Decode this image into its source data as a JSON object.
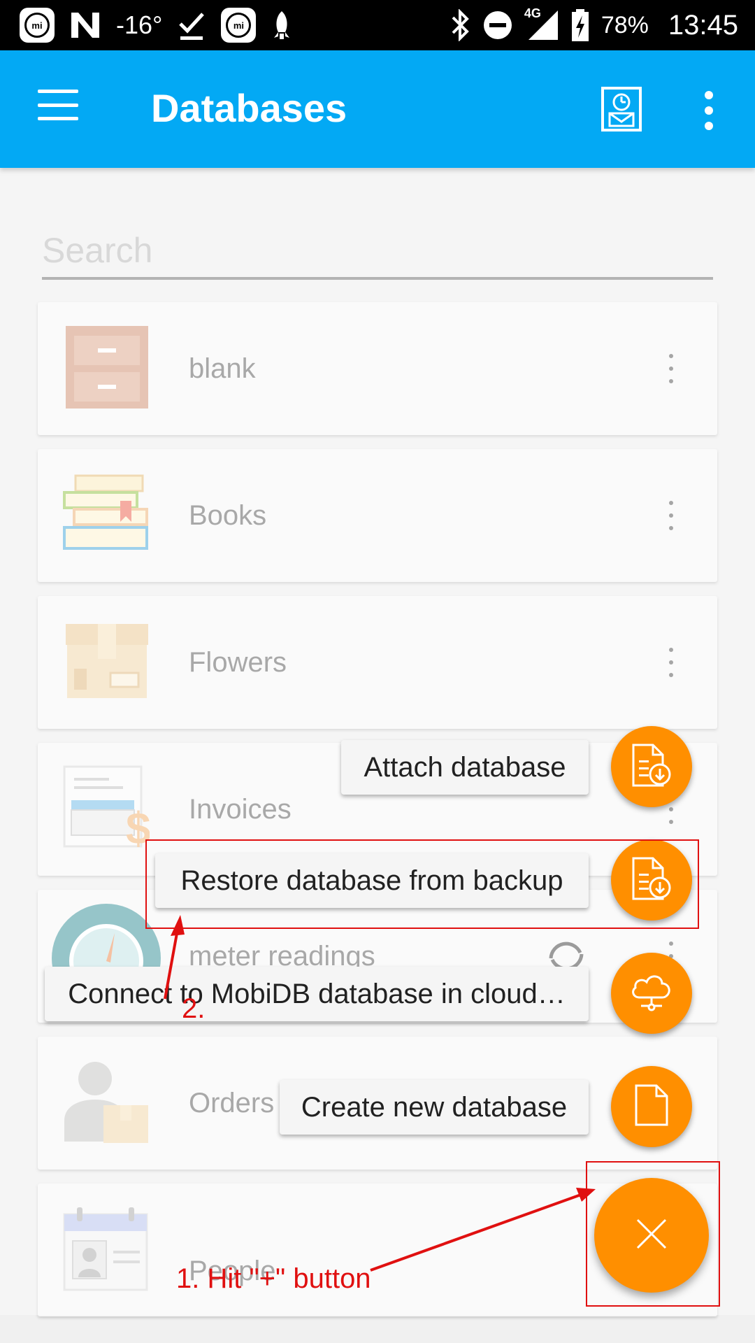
{
  "status_bar": {
    "temperature": "-16°",
    "network": "4G",
    "battery": "78%",
    "time": "13:45",
    "icons_left": [
      "mi-icon",
      "n-icon",
      "temperature-text",
      "download-done-icon",
      "mi-icon",
      "rocket-icon"
    ],
    "icons_right": [
      "bluetooth-icon",
      "do-not-disturb-icon",
      "signal-icon",
      "battery-charging-icon"
    ]
  },
  "app_bar": {
    "title": "Databases",
    "color": "#03a9f4"
  },
  "search": {
    "placeholder": "Search"
  },
  "databases": [
    {
      "name": "blank",
      "icon": "cabinet-icon"
    },
    {
      "name": "Books",
      "icon": "books-icon"
    },
    {
      "name": "Flowers",
      "icon": "box-icon"
    },
    {
      "name": "Invoices",
      "icon": "invoice-icon"
    },
    {
      "name": "meter readings",
      "icon": "gauge-icon"
    },
    {
      "name": "Orders",
      "icon": "person-box-icon"
    },
    {
      "name": "People",
      "icon": "contact-card-icon"
    }
  ],
  "fab_menu": {
    "accent": "#ff8f00",
    "items": [
      {
        "label": "Attach database",
        "icon": "file-download-icon"
      },
      {
        "label": "Restore database from backup",
        "icon": "file-download-icon"
      },
      {
        "label": "Connect to MobiDB database in cloud…",
        "icon": "cloud-network-icon"
      },
      {
        "label": "Create new database",
        "icon": "file-icon"
      }
    ],
    "main_icon": "close-icon"
  },
  "annotations": {
    "step1": "1. Hit \"+\" button",
    "step2": "2.",
    "color": "#e01010"
  }
}
